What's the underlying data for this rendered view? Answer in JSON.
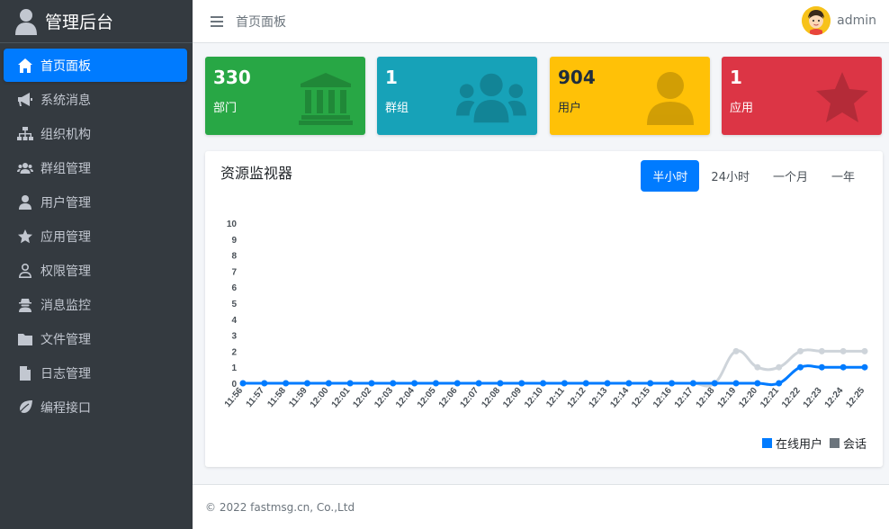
{
  "brand": {
    "title": "管理后台"
  },
  "header": {
    "breadcrumb": "首页面板",
    "username": "admin"
  },
  "sidebar": {
    "items": [
      {
        "label": "首页面板",
        "icon": "home-icon",
        "active": true
      },
      {
        "label": "系统消息",
        "icon": "bullhorn-icon"
      },
      {
        "label": "组织机构",
        "icon": "sitemap-icon"
      },
      {
        "label": "群组管理",
        "icon": "users-icon"
      },
      {
        "label": "用户管理",
        "icon": "user-icon"
      },
      {
        "label": "应用管理",
        "icon": "star-icon"
      },
      {
        "label": "权限管理",
        "icon": "user-outline-icon"
      },
      {
        "label": "消息监控",
        "icon": "user-secret-icon"
      },
      {
        "label": "文件管理",
        "icon": "folder-icon"
      },
      {
        "label": "日志管理",
        "icon": "file-icon"
      },
      {
        "label": "编程接口",
        "icon": "leaf-icon"
      }
    ]
  },
  "stats": [
    {
      "value": "330",
      "label": "部门",
      "icon": "bank-icon",
      "color": "#28a745"
    },
    {
      "value": "1",
      "label": "群组",
      "icon": "users-icon",
      "color": "#17a2b8"
    },
    {
      "value": "904",
      "label": "用户",
      "icon": "user-icon",
      "color": "#ffc107"
    },
    {
      "value": "1",
      "label": "应用",
      "icon": "star-icon",
      "color": "#dc3545"
    }
  ],
  "monitor": {
    "title": "资源监视器",
    "tabs": [
      {
        "label": "半小时",
        "active": true
      },
      {
        "label": "24小时"
      },
      {
        "label": "一个月"
      },
      {
        "label": "一年"
      }
    ]
  },
  "chart_data": {
    "type": "line",
    "x": [
      "11:56",
      "11:57",
      "11:58",
      "11:59",
      "12:00",
      "12:01",
      "12:02",
      "12:03",
      "12:04",
      "12:05",
      "12:06",
      "12:07",
      "12:08",
      "12:09",
      "12:10",
      "12:11",
      "12:12",
      "12:13",
      "12:14",
      "12:15",
      "12:16",
      "12:17",
      "12:18",
      "12:19",
      "12:20",
      "12:21",
      "12:22",
      "12:23",
      "12:24",
      "12:25"
    ],
    "ylim": [
      0,
      10
    ],
    "yticks": [
      0,
      1,
      2,
      3,
      4,
      5,
      6,
      7,
      8,
      9,
      10
    ],
    "series": [
      {
        "name": "在线用户",
        "color": "#007bff",
        "values": [
          0,
          0,
          0,
          0,
          0,
          0,
          0,
          0,
          0,
          0,
          0,
          0,
          0,
          0,
          0,
          0,
          0,
          0,
          0,
          0,
          0,
          0,
          0,
          0,
          0,
          0,
          1,
          1,
          1,
          1
        ]
      },
      {
        "name": "会话",
        "color": "#6c757d",
        "line_color": "#ced4da",
        "values": [
          0,
          0,
          0,
          0,
          0,
          0,
          0,
          0,
          0,
          0,
          0,
          0,
          0,
          0,
          0,
          0,
          0,
          0,
          0,
          0,
          0,
          0,
          0,
          2,
          1,
          1,
          2,
          2,
          2,
          2
        ]
      }
    ],
    "legend_position": "bottom-right"
  },
  "footer": {
    "text": "© 2022 fastmsg.cn, Co.,Ltd"
  }
}
